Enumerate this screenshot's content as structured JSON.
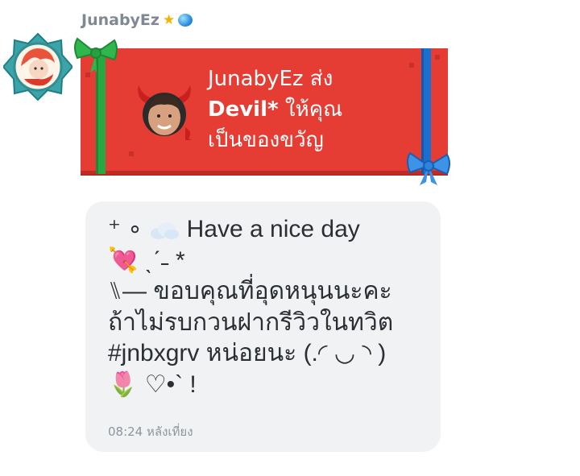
{
  "sender": {
    "name": "JunabyEz",
    "badges": [
      "star-icon",
      "gem-icon"
    ]
  },
  "gift": {
    "line1": "JunabyEz ส่ง",
    "item": "Devil*",
    "line2_suffix": " ให้คุณ",
    "line3": "เป็นของขวัญ",
    "card_color": "#e53c33",
    "ribbon_green": "#27a843",
    "ribbon_blue": "#1b6fd0"
  },
  "message": {
    "line1_prefix": "⁺  ∘  ",
    "line1_text": "  Have a nice day",
    "line2": "💘 ˎˊ˗  *",
    "line3": "⑊— ขอบคุณที่อุดหนุนนะคะ",
    "line4": "ถ้าไม่รบกวนฝากรีวิวในทวิต",
    "line5": "#jnbxgrv หน่อยนะ (.◜ ◡ ◝ )",
    "line6": "🌷 ♡•` !",
    "timestamp": "08:24 หลังเที่ยง"
  },
  "colors": {
    "bubble": "#f1f2f4",
    "text": "#2b2e33",
    "timestamp": "#8d949c"
  }
}
